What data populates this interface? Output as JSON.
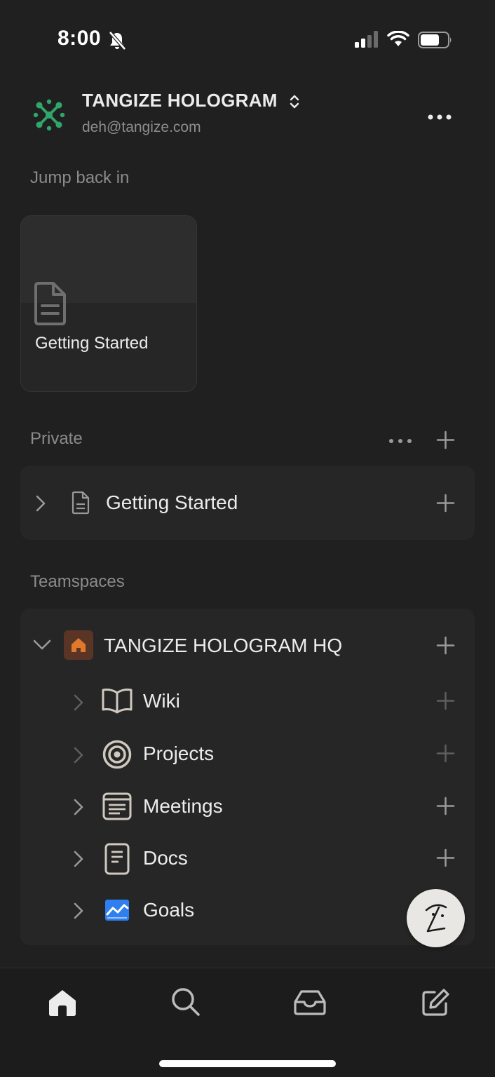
{
  "status_bar": {
    "time": "8:00"
  },
  "workspace": {
    "name": "TANGIZE HOLOGRAM",
    "email": "deh@tangize.com",
    "logo_color": "#2fa66a"
  },
  "jump_back": {
    "title": "Jump back in",
    "cards": [
      {
        "title": "Getting Started",
        "icon": "page-icon"
      }
    ]
  },
  "private": {
    "title": "Private",
    "items": [
      {
        "label": "Getting Started",
        "icon": "page-icon"
      }
    ]
  },
  "teamspaces": {
    "title": "Teamspaces",
    "team": {
      "label": "TANGIZE HOLOGRAM HQ",
      "icon": "home-icon",
      "icon_color": "#e0782d"
    },
    "items": [
      {
        "label": "Wiki",
        "icon": "book-icon"
      },
      {
        "label": "Projects",
        "icon": "target-icon"
      },
      {
        "label": "Meetings",
        "icon": "notes-icon"
      },
      {
        "label": "Docs",
        "icon": "doc-icon"
      },
      {
        "label": "Goals",
        "icon": "chart-icon",
        "icon_color": "#2f7ff0"
      }
    ]
  },
  "tab_bar": {
    "tabs": [
      {
        "name": "home",
        "icon": "home-icon"
      },
      {
        "name": "search",
        "icon": "search-icon"
      },
      {
        "name": "inbox",
        "icon": "inbox-icon"
      },
      {
        "name": "new-page",
        "icon": "compose-icon"
      }
    ]
  }
}
